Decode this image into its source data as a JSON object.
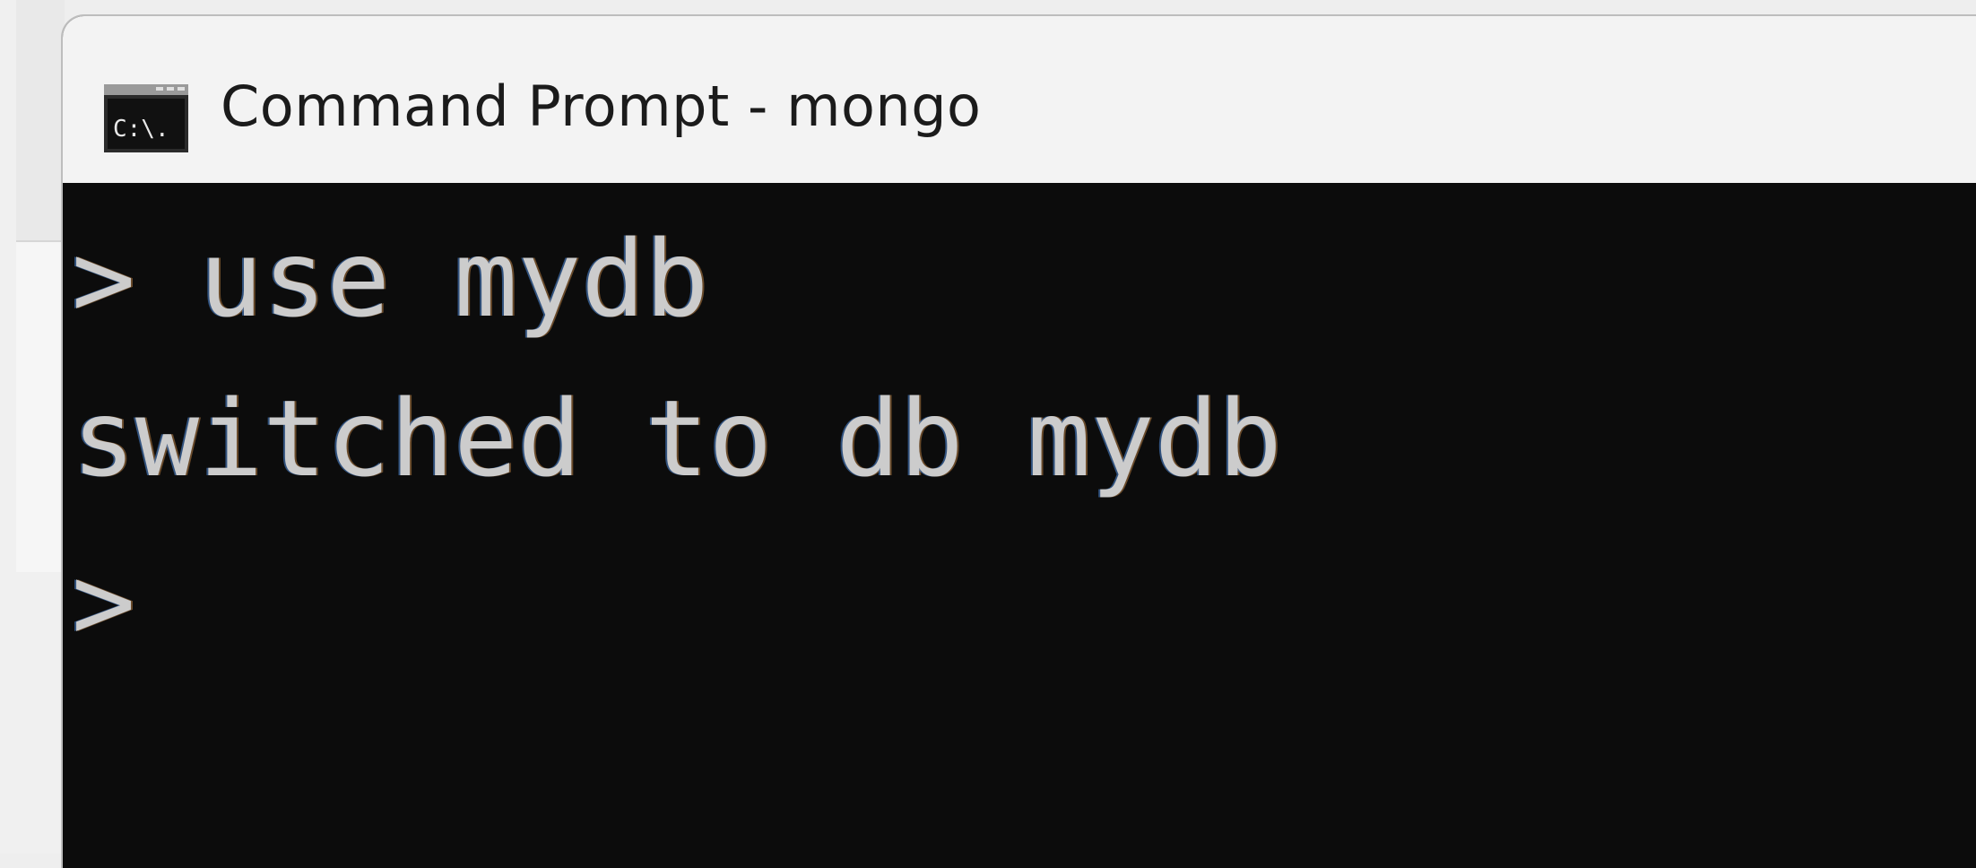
{
  "window": {
    "title": "Command Prompt - mongo",
    "icon": "command-prompt-icon",
    "icon_label": "C:\\."
  },
  "console": {
    "lines": [
      "> use mydb",
      "switched to db mydb",
      ">"
    ],
    "colors": {
      "background": "#0c0c0c",
      "text": "#cccccc"
    }
  }
}
